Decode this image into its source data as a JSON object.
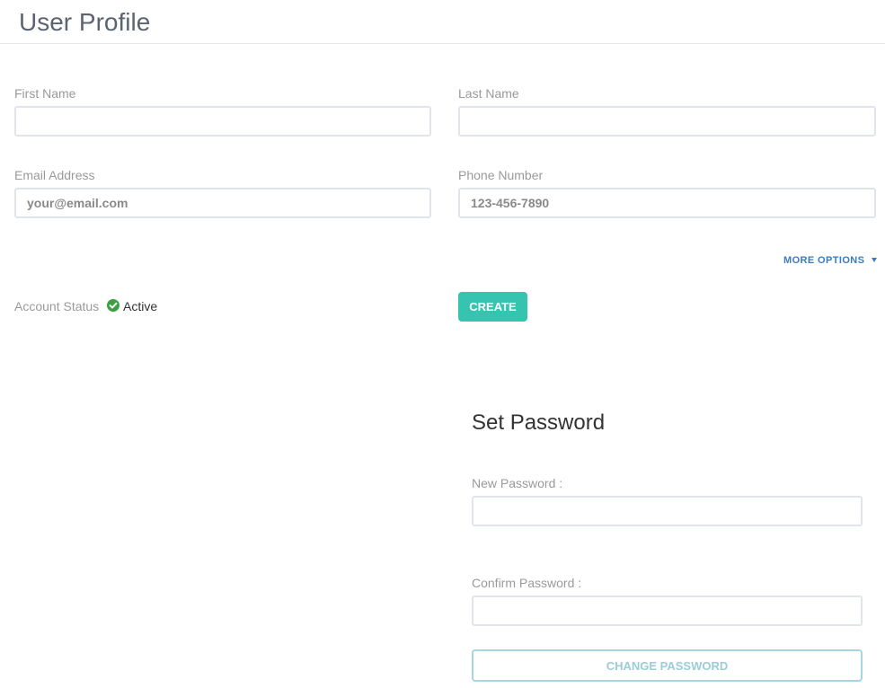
{
  "header": {
    "title": "User Profile"
  },
  "form": {
    "first_name": {
      "label": "First Name",
      "value": "",
      "placeholder": ""
    },
    "last_name": {
      "label": "Last Name",
      "value": "",
      "placeholder": ""
    },
    "email": {
      "label": "Email Address",
      "value": "",
      "placeholder": "your@email.com"
    },
    "phone": {
      "label": "Phone Number",
      "value": "",
      "placeholder": "123-456-7890"
    },
    "more_options": {
      "label": "MORE OPTIONS",
      "icon": "caret-down-icon"
    },
    "account_status": {
      "label": "Account Status",
      "value": "Active",
      "icon": "check-circle-icon",
      "icon_color": "#3aa041"
    },
    "create_button": {
      "label": "CREATE",
      "color": "#36c4b0"
    }
  },
  "password_section": {
    "title": "Set Password",
    "new_password": {
      "label": "New Password :",
      "value": ""
    },
    "confirm_password": {
      "label": "Confirm Password :",
      "value": ""
    },
    "change_button": {
      "label": "CHANGE PASSWORD"
    }
  },
  "colors": {
    "accent": "#36c4b0",
    "link": "#3b7bbf",
    "label": "#9a9a9a",
    "input_border": "#e1e5ea"
  }
}
